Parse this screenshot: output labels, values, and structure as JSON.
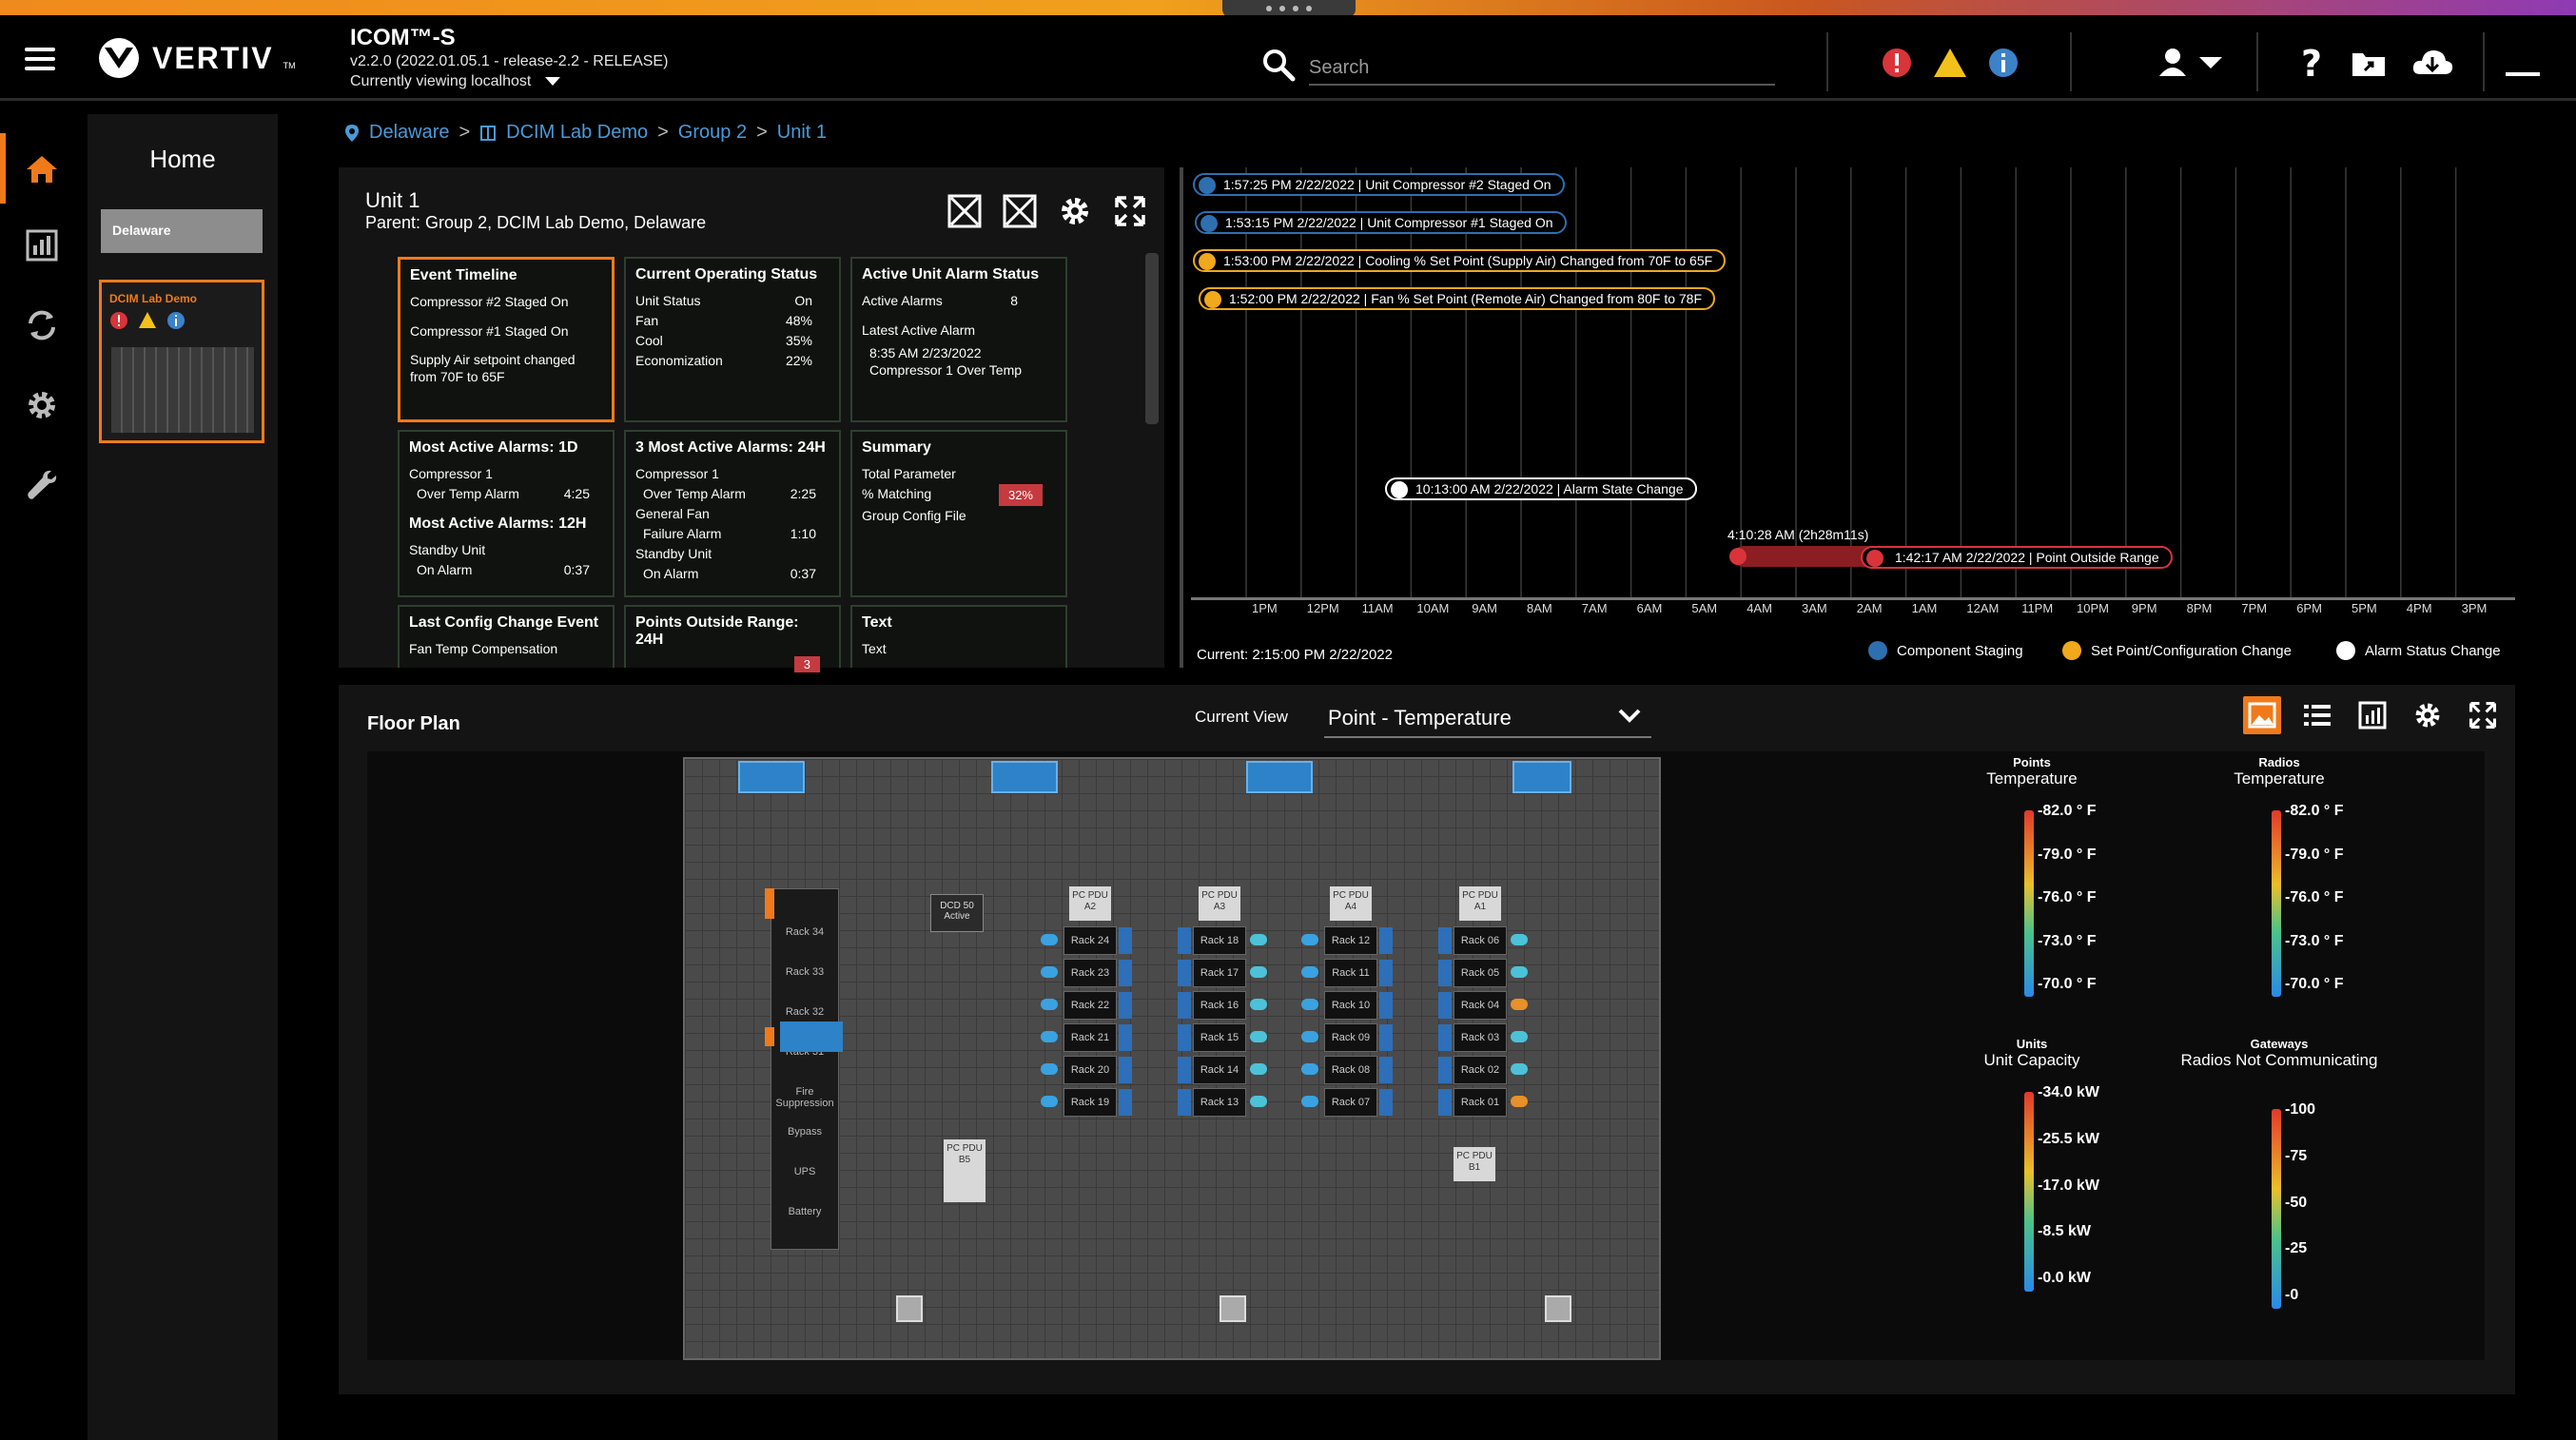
{
  "header": {
    "product_name": "ICOM™-S",
    "version": "v2.2.0 (2022.01.05.1 - release-2.2 - RELEASE)",
    "viewing": "Currently viewing localhost",
    "logo_text": "VERTIV",
    "logo_tm": "TM",
    "search_placeholder": "Search"
  },
  "sidebar": {
    "home_title": "Home",
    "site_item": "Delaware",
    "card_title": "DCIM Lab Demo"
  },
  "breadcrumb": [
    "Delaware",
    "DCIM Lab Demo",
    "Group 2",
    "Unit 1"
  ],
  "unit": {
    "title": "Unit 1",
    "parent": "Parent: Group 2, DCIM Lab Demo, Delaware",
    "event_timeline": {
      "title": "Event Timeline",
      "items": [
        "Compressor #2 Staged On",
        "Compressor #1 Staged On",
        "Supply Air setpoint changed from 70F to 65F"
      ]
    },
    "operating_status": {
      "title": "Current Operating Status",
      "rows": [
        {
          "label": "Unit Status",
          "value": "On"
        },
        {
          "label": "Fan",
          "value": "48%"
        },
        {
          "label": "Cool",
          "value": "35%"
        },
        {
          "label": "Economization",
          "value": "22%"
        }
      ]
    },
    "alarm_status": {
      "title": "Active Unit Alarm Status",
      "active_label": "Active Alarms",
      "active_value": "8",
      "latest_label": "Latest Active Alarm",
      "latest_time": "8:35 AM 2/23/2022",
      "latest_text": "Compressor 1 Over Temp"
    },
    "most_active_1d": {
      "title": "Most Active Alarms: 1D",
      "line1": "Compressor 1",
      "line2": "Over Temp Alarm",
      "value": "4:25",
      "title2": "Most Active Alarms: 12H",
      "line3": "Standby Unit",
      "line4": "On Alarm",
      "value2": "0:37"
    },
    "three_most_active": {
      "title": "3 Most Active Alarms: 24H",
      "a1": "Compressor 1",
      "a1b": "Over Temp Alarm",
      "a1v": "2:25",
      "a2": "General Fan",
      "a2b": "Failure Alarm",
      "a2v": "1:10",
      "a3": "Standby Unit",
      "a3b": "On Alarm",
      "a3v": "0:37"
    },
    "summary": {
      "title": "Summary",
      "l1": "Total Parameter",
      "l2": "% Matching",
      "badge": "32%",
      "l3": "Group Config File"
    },
    "last_config": {
      "title": "Last Config Change Event",
      "text": "Fan Temp Compensation"
    },
    "points_outside": {
      "title": "Points Outside Range: 24H",
      "badge": "3"
    },
    "text_tile": {
      "title": "Text",
      "text": "Text"
    }
  },
  "timeline": {
    "events": [
      {
        "text": "1:57:25 PM 2/22/2022  |  Unit Compressor #2 Staged On",
        "kind": "staging"
      },
      {
        "text": "1:53:15 PM 2/22/2022  |  Unit Compressor #1 Staged On",
        "kind": "staging"
      },
      {
        "text": "1:53:00 PM 2/22/2022  |  Cooling % Set Point (Supply Air) Changed from 70F to 65F",
        "kind": "config"
      },
      {
        "text": "1:52:00 PM 2/22/2022  |  Fan % Set Point (Remote Air) Changed from 80F to 78F",
        "kind": "config"
      },
      {
        "text": "10:13:00 AM 2/22/2022  |  Alarm State Change",
        "kind": "alarm"
      },
      {
        "text": "1:42:17 AM 2/22/2022  |  Point Outside Range",
        "kind": "range"
      }
    ],
    "duration_label": "4:10:28 AM (2h28m11s)",
    "ticks": [
      "1PM",
      "12PM",
      "11AM",
      "10AM",
      "9AM",
      "8AM",
      "7AM",
      "6AM",
      "5AM",
      "4AM",
      "3AM",
      "2AM",
      "1AM",
      "12AM",
      "11PM",
      "10PM",
      "9PM",
      "8PM",
      "7PM",
      "6PM",
      "5PM",
      "4PM",
      "3PM"
    ],
    "current": "Current:  2:15:00 PM  2/22/2022",
    "legend": [
      {
        "label": "Component Staging",
        "color": "#2e6fb0"
      },
      {
        "label": "Set Point/Configuration Change",
        "color": "#f0a81c"
      },
      {
        "label": "Alarm Status Change",
        "color": "#ffffff"
      }
    ]
  },
  "floorplan": {
    "title": "Floor Plan",
    "current_view_label": "Current View",
    "current_view_value": "Point - Temperature",
    "racks_a": [
      "Rack 24",
      "Rack 23",
      "Rack 22",
      "Rack 21",
      "Rack 20",
      "Rack 19"
    ],
    "racks_b": [
      "Rack 18",
      "Rack 17",
      "Rack 16",
      "Rack 15",
      "Rack 14",
      "Rack 13"
    ],
    "racks_c": [
      "Rack 12",
      "Rack 11",
      "Rack 10",
      "Rack 09",
      "Rack 08",
      "Rack 07"
    ],
    "racks_d": [
      "Rack 06",
      "Rack 05",
      "Rack 04",
      "Rack 03",
      "Rack 02",
      "Rack 01"
    ],
    "left_column": [
      "Rack 34",
      "Rack 33",
      "Rack 32",
      "Rack 31",
      "Fire Suppression",
      "Bypass",
      "UPS",
      "Battery"
    ],
    "pdus": [
      "PC PDU A2",
      "PC PDU A3",
      "PC PDU A4",
      "PC PDU A1",
      "PC PDU B5",
      "PC PDU B1"
    ],
    "dcd": "DCD 50 Active",
    "legends": [
      {
        "h1": "Points",
        "h2": "Temperature",
        "labels": [
          "82.0 ° F",
          "79.0 ° F",
          "76.0 ° F",
          "73.0 ° F",
          "70.0 ° F"
        ]
      },
      {
        "h1": "Radios",
        "h2": "Temperature",
        "labels": [
          "82.0 ° F",
          "79.0 ° F",
          "76.0 ° F",
          "73.0 ° F",
          "70.0 ° F"
        ]
      },
      {
        "h1": "Units",
        "h2": "Unit Capacity",
        "labels": [
          "34.0 kW",
          "25.5 kW",
          "17.0 kW",
          "8.5 kW",
          "0.0 kW"
        ]
      },
      {
        "h1": "Gateways",
        "h2": "Radios Not Communicating",
        "labels": [
          "100",
          "75",
          "50",
          "25",
          "0"
        ]
      }
    ]
  },
  "colors": {
    "accent": "#f07a1a",
    "link": "#4a9ad8",
    "alarm_red": "#d9343a",
    "warning_yellow": "#f2c21a",
    "info_blue": "#3b82c9"
  }
}
